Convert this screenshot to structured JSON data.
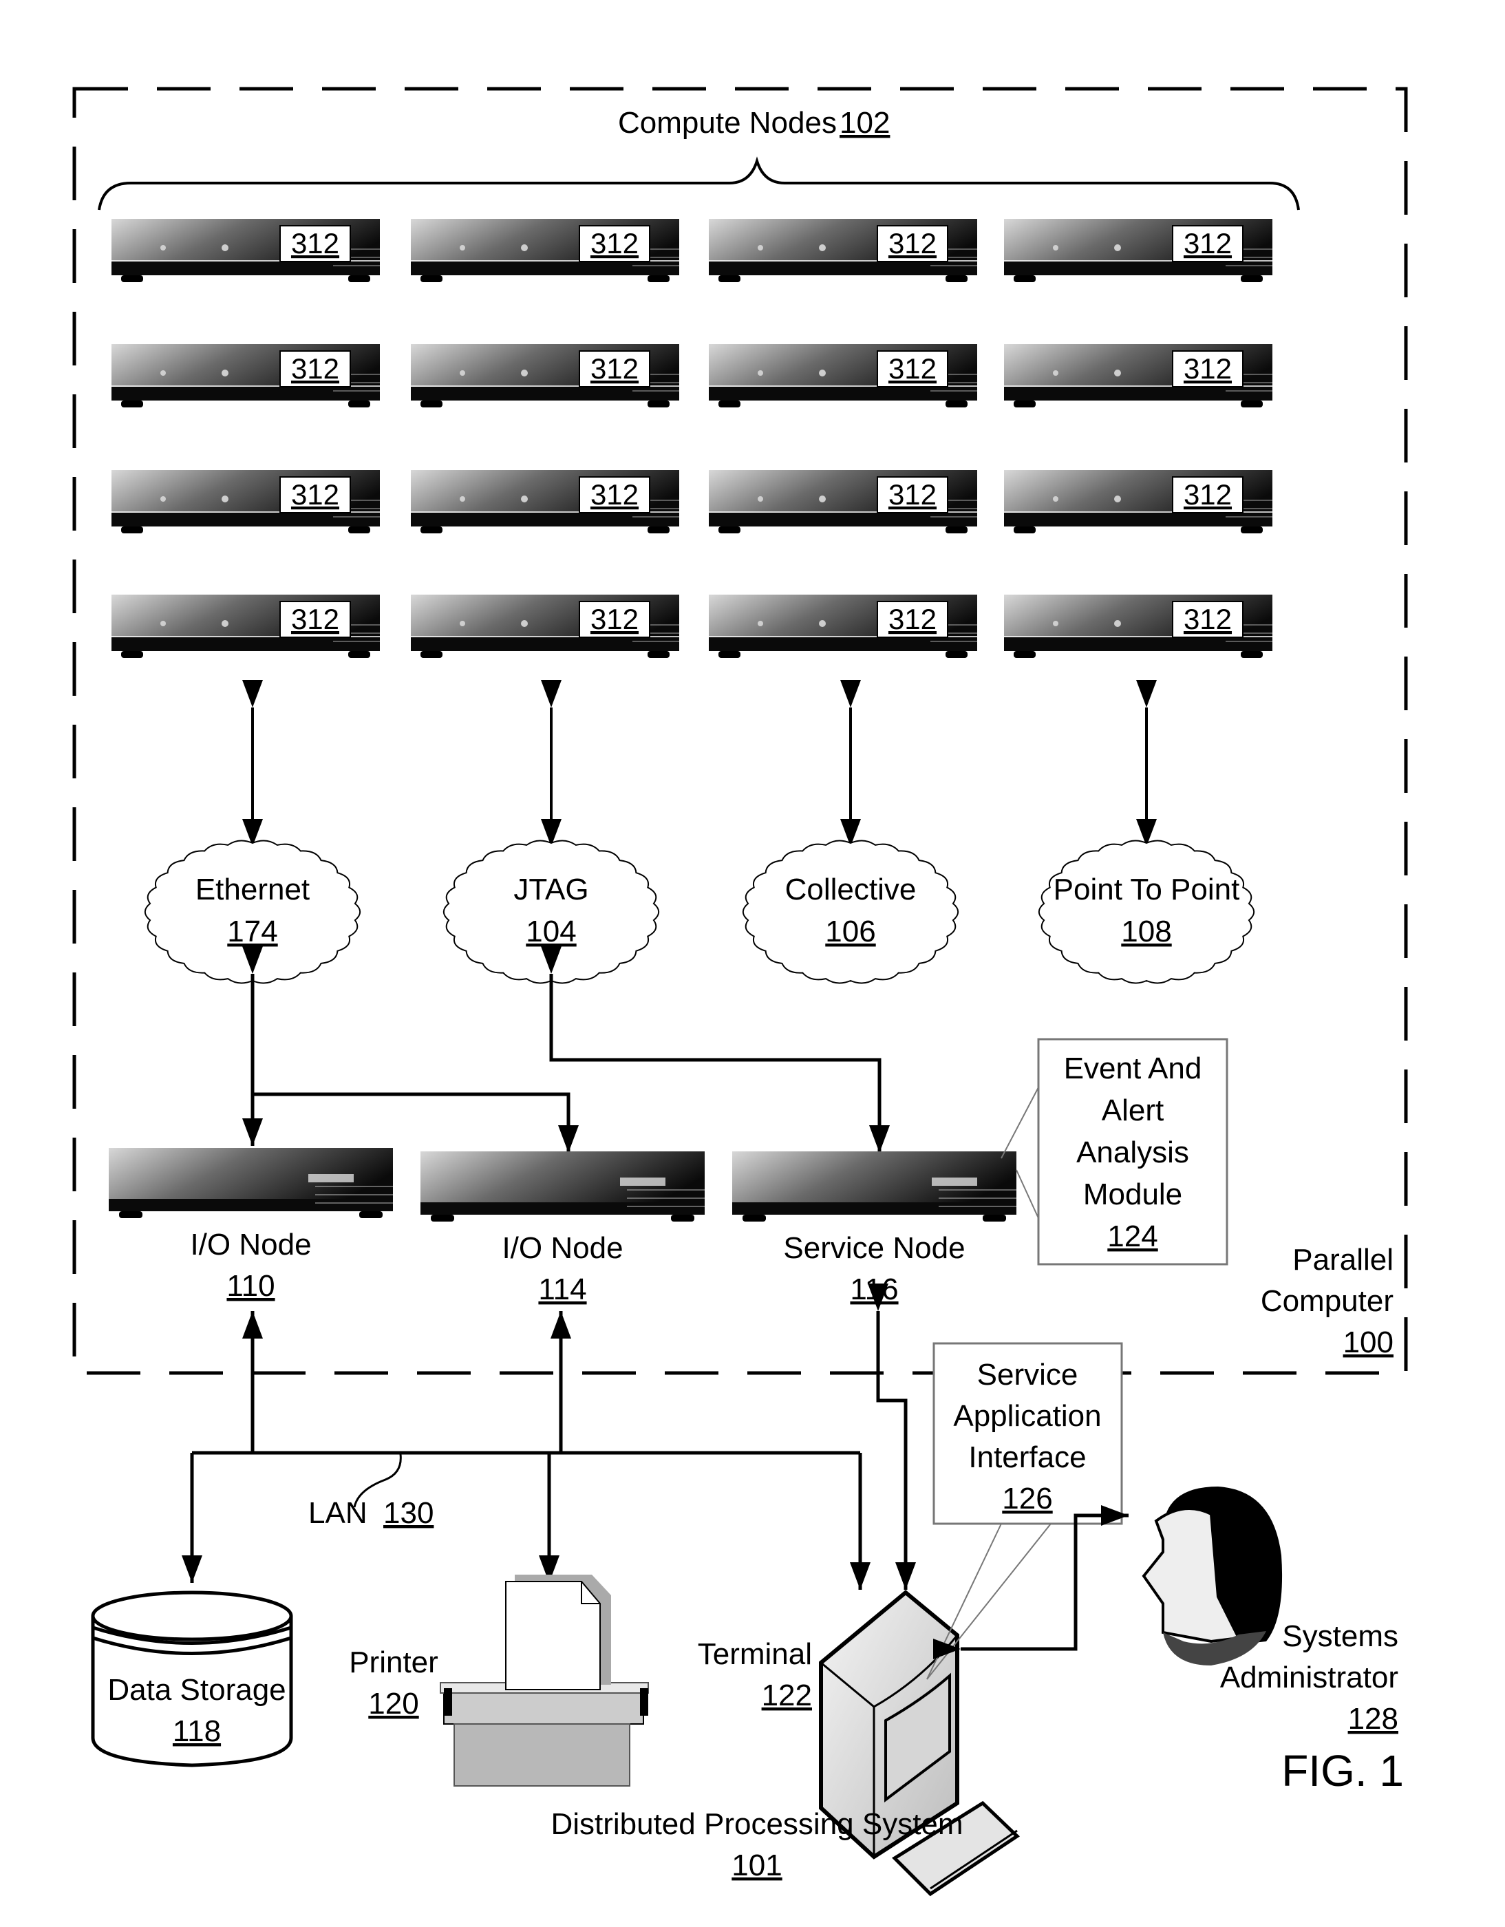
{
  "figure": {
    "label": "FIG. 1",
    "system_title": "Distributed Processing System",
    "system_ref": "101"
  },
  "parallel_computer": {
    "label_line1": "Parallel",
    "label_line2": "Computer",
    "ref": "100"
  },
  "compute_nodes": {
    "title": "Compute Nodes",
    "ref": "102",
    "node_ref": "312",
    "rows": 4,
    "cols": 4
  },
  "networks": [
    {
      "name": "Ethernet",
      "ref": "174"
    },
    {
      "name": "JTAG",
      "ref": "104"
    },
    {
      "name": "Collective",
      "ref": "106"
    },
    {
      "name": "Point To Point",
      "ref": "108"
    }
  ],
  "nodes": [
    {
      "name": "I/O Node",
      "ref": "110"
    },
    {
      "name": "I/O Node",
      "ref": "114"
    },
    {
      "name": "Service Node",
      "ref": "116"
    }
  ],
  "event_module": {
    "line1": "Event And",
    "line2": "Alert",
    "line3": "Analysis",
    "line4": "Module",
    "ref": "124"
  },
  "service_app": {
    "line1": "Service",
    "line2": "Application",
    "line3": "Interface",
    "ref": "126"
  },
  "lan": {
    "name": "LAN",
    "ref": "130"
  },
  "data_storage": {
    "name": "Data Storage",
    "ref": "118"
  },
  "printer": {
    "name": "Printer",
    "ref": "120"
  },
  "terminal": {
    "name": "Terminal",
    "ref": "122"
  },
  "admin": {
    "line1": "Systems",
    "line2": "Administrator",
    "ref": "128"
  }
}
